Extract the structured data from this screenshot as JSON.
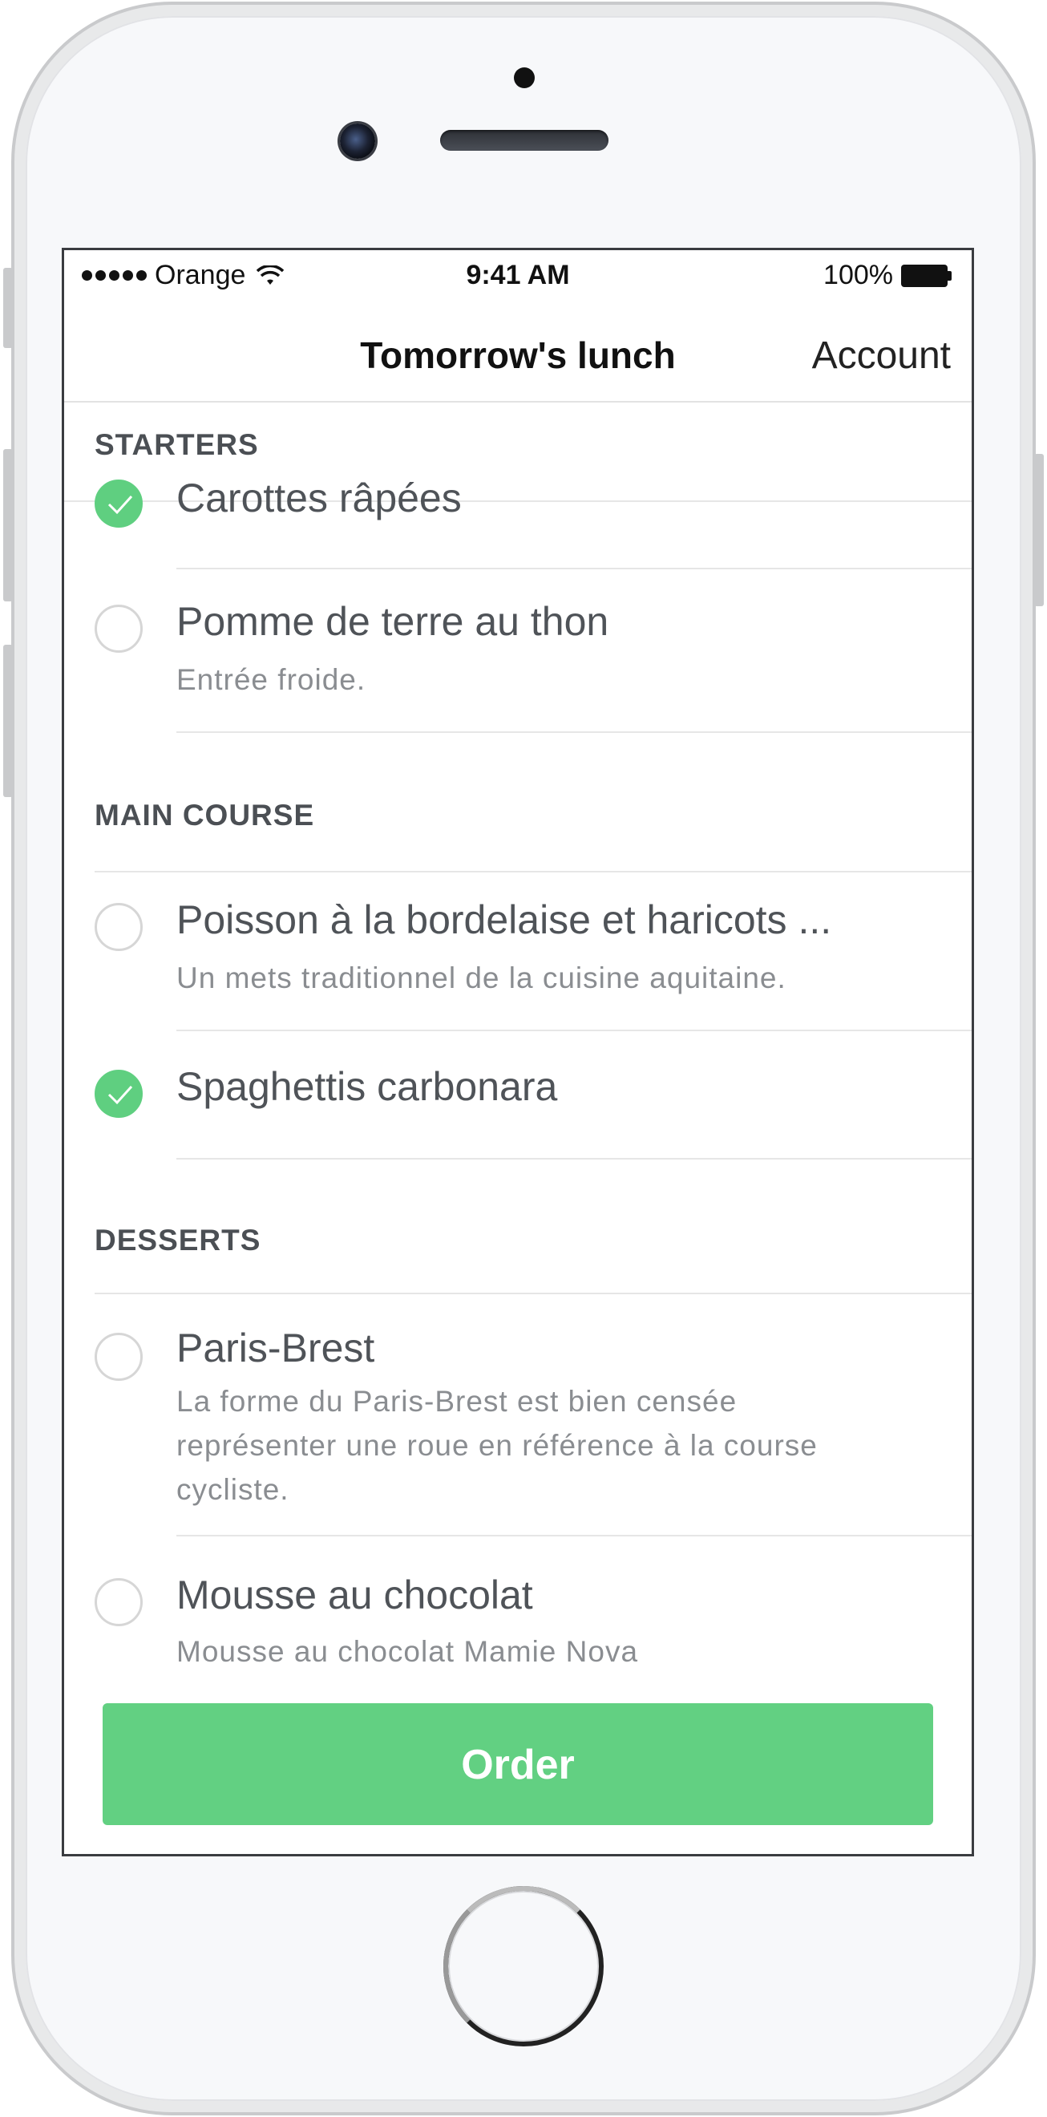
{
  "status_bar": {
    "carrier": "Orange",
    "time": "9:41 AM",
    "battery": "100%"
  },
  "nav": {
    "title": "Tomorrow's lunch",
    "account_label": "Account"
  },
  "sections": [
    {
      "header": "STARTERS",
      "items": [
        {
          "title": "Carottes râpées",
          "subtitle": "",
          "checked": true
        },
        {
          "title": "Pomme de terre au thon",
          "subtitle": "Entrée froide.",
          "checked": false
        }
      ]
    },
    {
      "header": "MAIN COURSE",
      "items": [
        {
          "title": "Poisson à la bordelaise et haricots ...",
          "subtitle": "Un mets traditionnel de la cuisine aquitaine.",
          "checked": false
        },
        {
          "title": "Spaghettis carbonara",
          "subtitle": "",
          "checked": true
        }
      ]
    },
    {
      "header": "DESSERTS",
      "items": [
        {
          "title": "Paris-Brest",
          "subtitle": "La forme du Paris-Brest est bien censée représenter une roue en référence à la course cycliste.",
          "checked": false
        },
        {
          "title": "Mousse au chocolat",
          "subtitle": "Mousse au chocolat Mamie Nova",
          "checked": false
        }
      ]
    }
  ],
  "order_button": "Order",
  "colors": {
    "accent_green": "#62d082",
    "text_primary": "#4f5358",
    "text_secondary": "#8a8d91"
  },
  "icons": [
    "signal-dots-icon",
    "wifi-icon",
    "battery-icon",
    "checkmark-icon"
  ]
}
